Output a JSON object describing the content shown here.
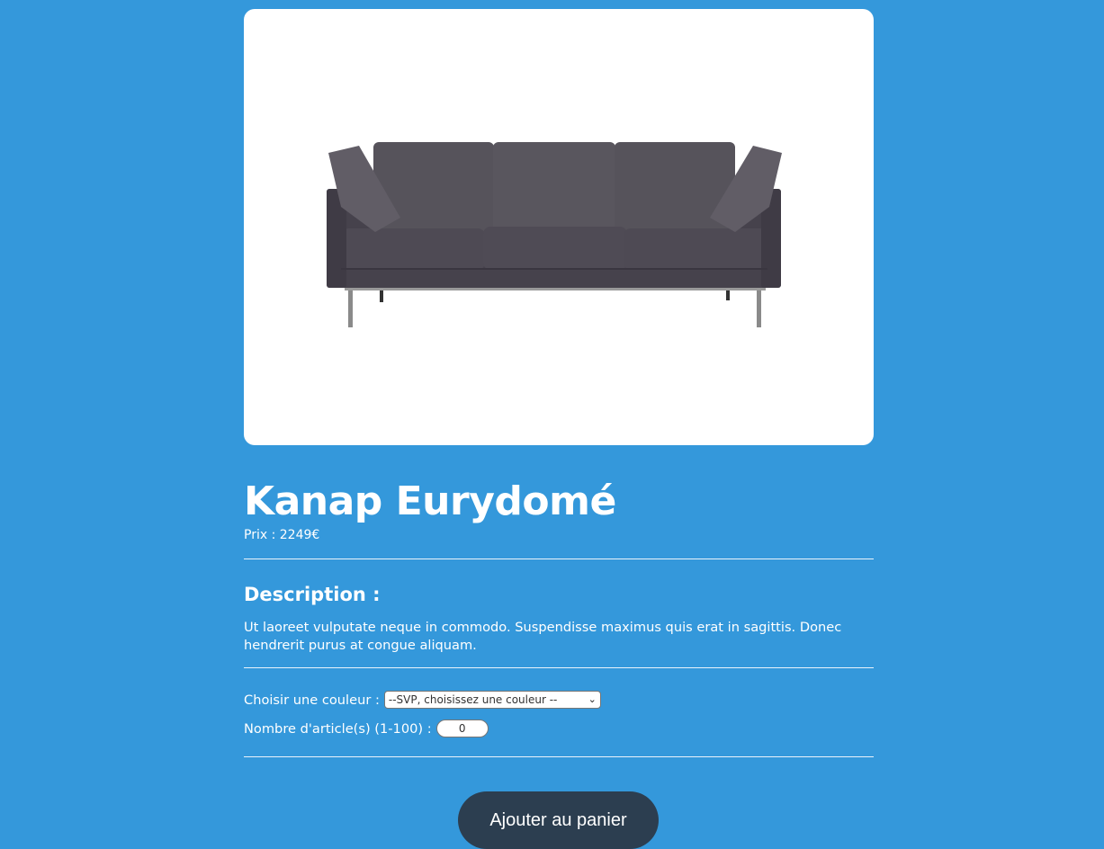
{
  "product": {
    "image_alt": "Kanap sofa image",
    "title": "Kanap Eurydomé",
    "price_label": "Prix : ",
    "price_value": "2249",
    "price_currency": "€"
  },
  "description": {
    "heading": "Description :",
    "text": "Ut laoreet vulputate neque in commodo. Suspendisse maximus quis erat in sagittis. Donec hendrerit purus at congue aliquam."
  },
  "options": {
    "color_label": "Choisir une couleur : ",
    "color_selected": "--SVP, choisissez une couleur --",
    "quantity_label": "Nombre d'article(s) (1-100) : ",
    "quantity_value": "0"
  },
  "actions": {
    "add_to_cart_label": "Ajouter au panier"
  },
  "colors": {
    "background": "#3498db",
    "button": "#2c3e50",
    "card": "#ffffff"
  }
}
